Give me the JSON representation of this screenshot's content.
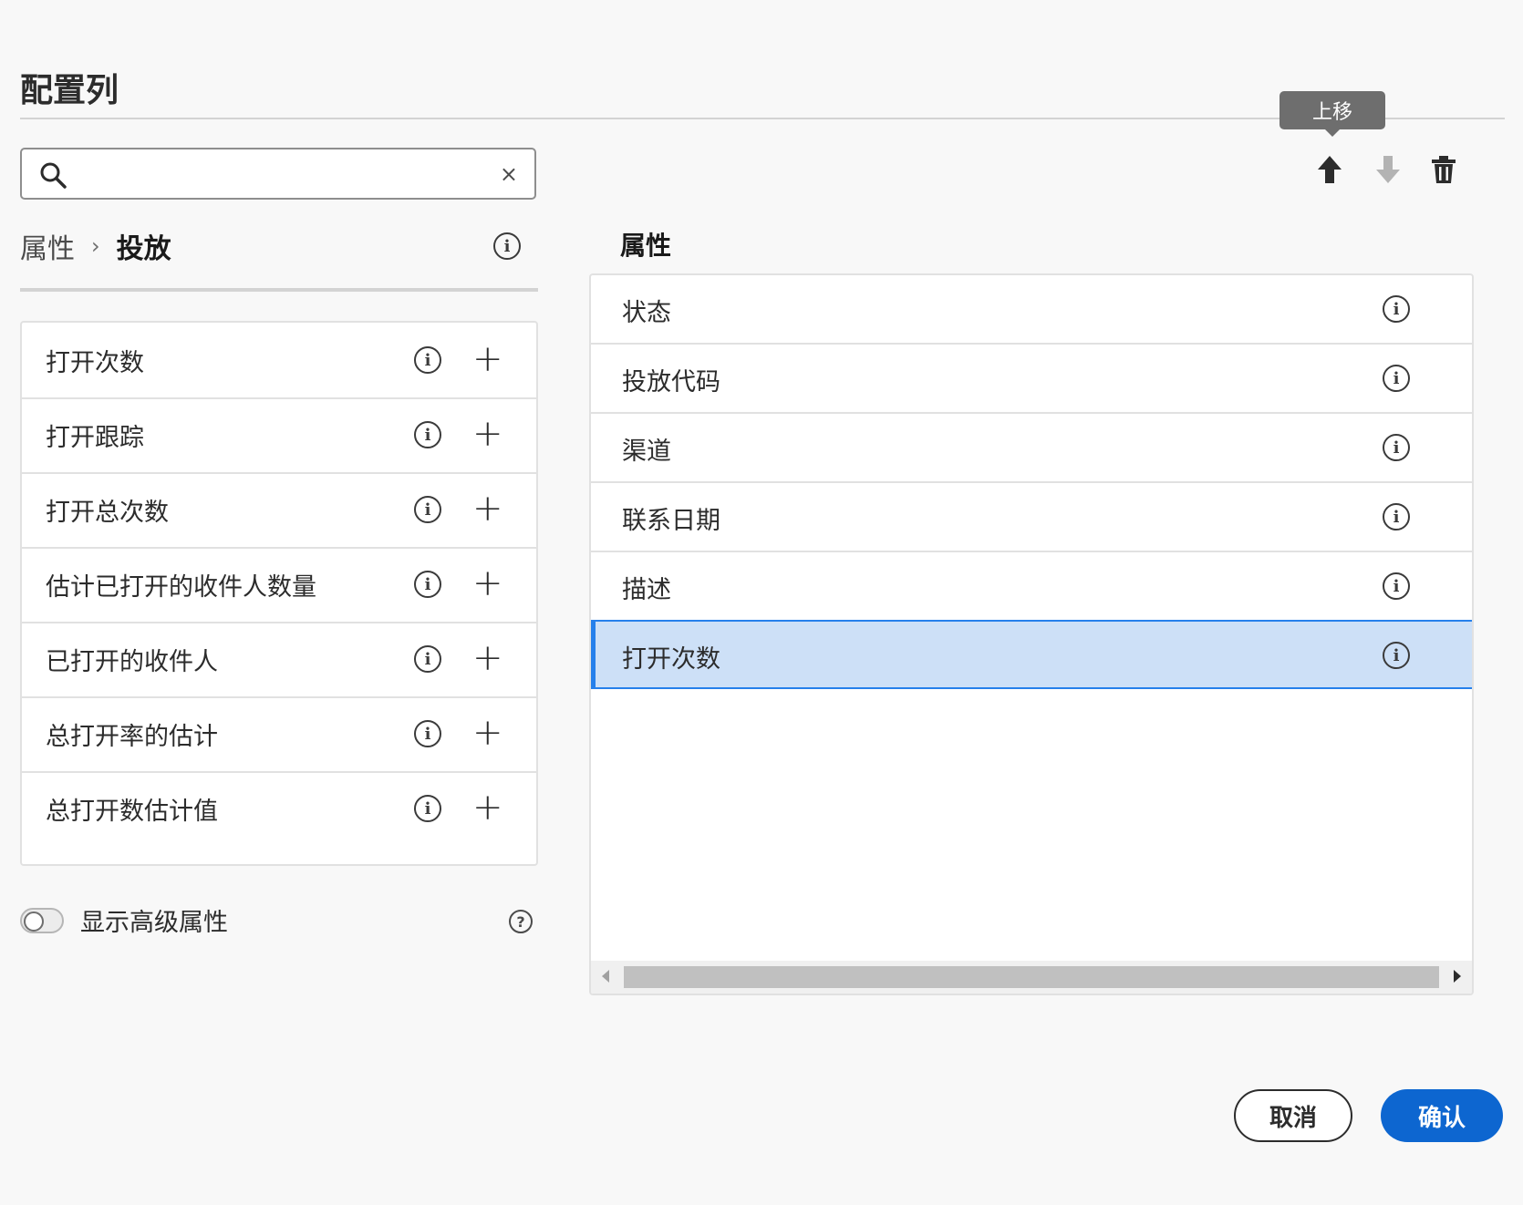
{
  "dialog": {
    "title": "配置列"
  },
  "search": {
    "value": "",
    "placeholder": "",
    "clear_glyph": "×"
  },
  "breadcrumb": {
    "root": "属性",
    "separator": "›",
    "current": "投放"
  },
  "available_attributes": [
    {
      "label": "打开次数"
    },
    {
      "label": "打开跟踪"
    },
    {
      "label": "打开总次数"
    },
    {
      "label": "估计已打开的收件人数量"
    },
    {
      "label": "已打开的收件人"
    },
    {
      "label": "总打开率的估计"
    },
    {
      "label": "总打开数估计值"
    }
  ],
  "advanced_toggle": {
    "label": "显示高级属性",
    "on": false
  },
  "toolbar": {
    "tooltip": "上移"
  },
  "selected_columns": {
    "header": "属性",
    "rows": [
      {
        "label": "状态",
        "selected": false
      },
      {
        "label": "投放代码",
        "selected": false
      },
      {
        "label": "渠道",
        "selected": false
      },
      {
        "label": "联系日期",
        "selected": false
      },
      {
        "label": "描述",
        "selected": false
      },
      {
        "label": "打开次数",
        "selected": true
      }
    ]
  },
  "footer": {
    "cancel_label": "取消",
    "confirm_label": "确认"
  },
  "colors": {
    "accent": "#0d66d0",
    "selection_bg": "#cde0f7",
    "selection_border": "#2680eb",
    "tooltip_bg": "#6e6e6e"
  },
  "icons": {
    "search": "search-icon",
    "clear": "clear-icon",
    "info": "info-icon",
    "add": "plus-icon",
    "help": "help-icon",
    "move_up": "arrow-up-icon",
    "move_down": "arrow-down-icon",
    "delete": "trash-icon"
  }
}
